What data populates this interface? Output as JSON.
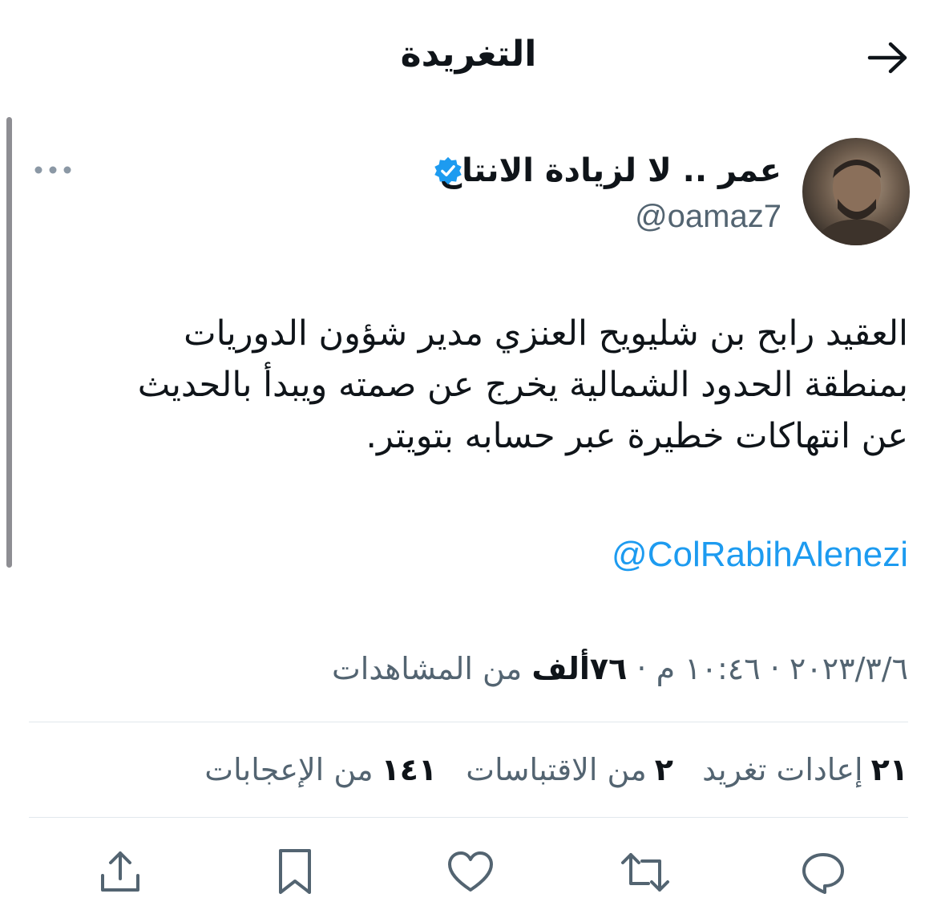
{
  "header": {
    "title": "التغريدة"
  },
  "author": {
    "name": "عمر .. لا لزيادة الانتاج",
    "handle": "@oamaz7"
  },
  "tweet": {
    "lines": [
      "العقيد رابح بن شليويح العنزي مدير شؤون الدوريات",
      "بمنطقة الحدود الشمالية يخرج عن صمته ويبدأ بالحديث",
      "عن انتهاكات خطيرة عبر حسابه بتويتر."
    ],
    "mention": "@ColRabihAlenezi"
  },
  "meta": {
    "date": "٢٠٢٣/٣/٦",
    "separator": "·",
    "time": "١٠:٤٦ م",
    "views_count": "٧٦ألف",
    "views_label": "من المشاهدات"
  },
  "stats": {
    "retweets_count": "٢١",
    "retweets_label": "إعادات تغريد",
    "quotes_count": "٢",
    "quotes_label": "من الاقتباسات",
    "likes_count": "١٤١",
    "likes_label": "من الإعجابات"
  },
  "colors": {
    "accent": "#1d9bf0",
    "secondary_text": "#536471",
    "primary_text": "#0f1419"
  },
  "icons": {
    "back": "arrow-right-icon",
    "verified": "verified-badge-icon",
    "more": "more-dots-icon",
    "reply": "reply-icon",
    "retweet": "retweet-icon",
    "like": "heart-icon",
    "bookmark": "bookmark-icon",
    "share": "share-icon"
  }
}
